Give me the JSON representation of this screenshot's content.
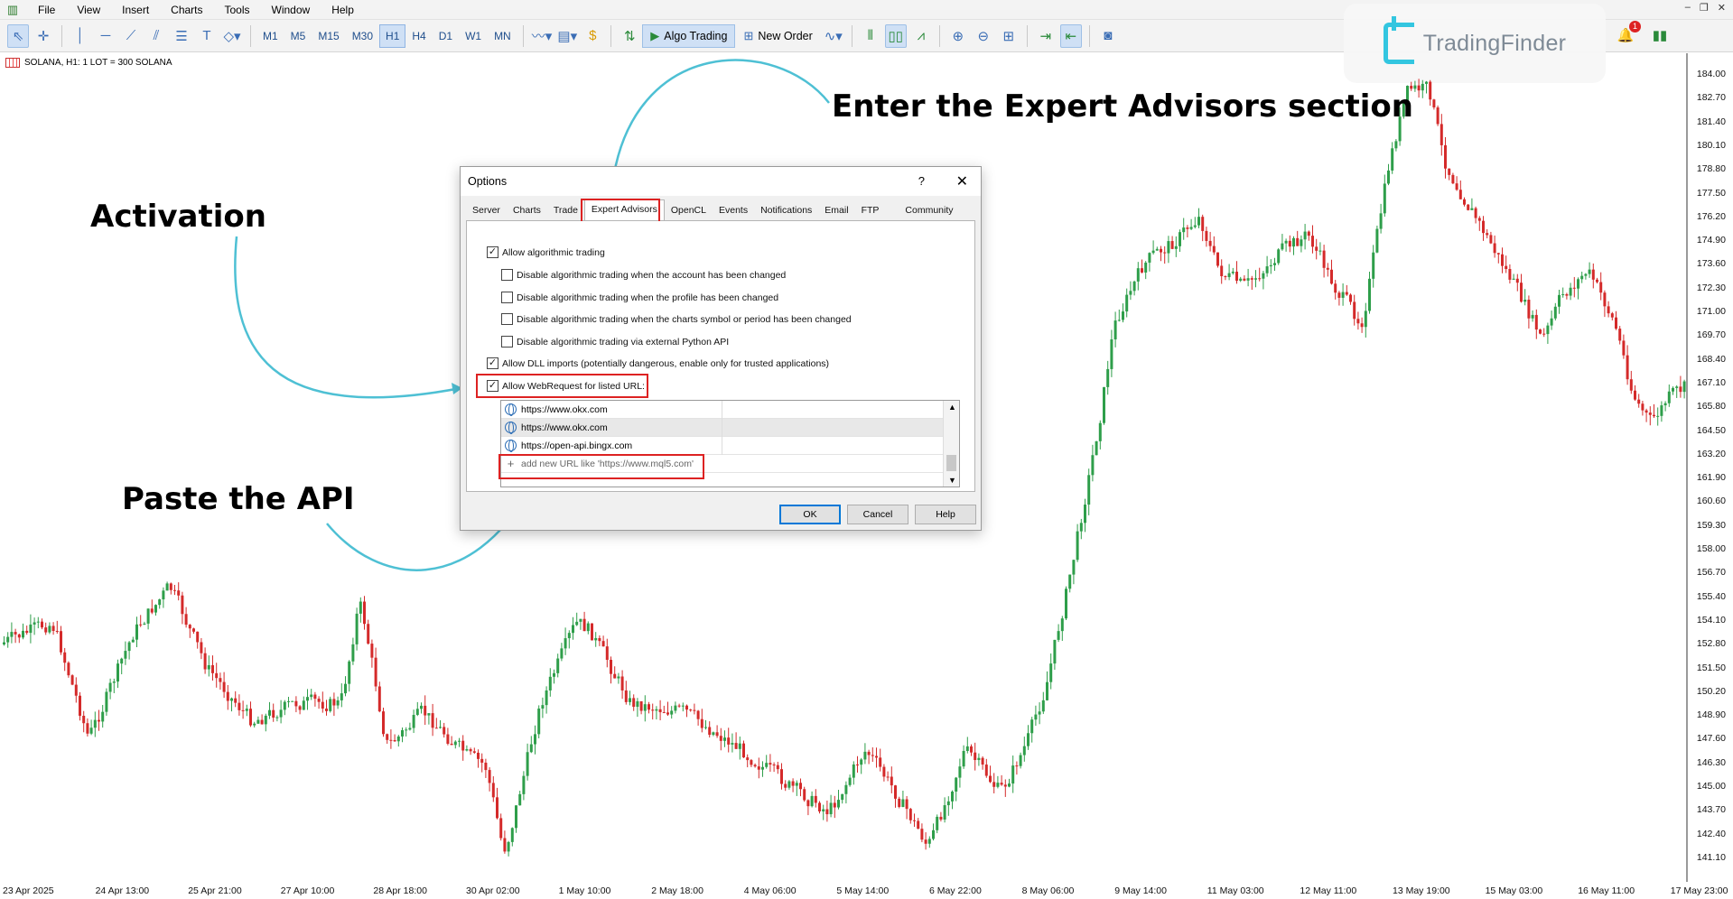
{
  "menu": [
    "File",
    "View",
    "Insert",
    "Charts",
    "Tools",
    "Window",
    "Help"
  ],
  "window_controls": {
    "minimize": "–",
    "restore": "❐",
    "close": "✕"
  },
  "toolbar": {
    "timeframes": [
      "M1",
      "M5",
      "M15",
      "M30",
      "H1",
      "H4",
      "D1",
      "W1",
      "MN"
    ],
    "active_timeframe": "H1",
    "algo_trading_label": "Algo Trading",
    "new_order_label": "New Order",
    "notification_count": "1"
  },
  "logo": {
    "text": "TradingFinder"
  },
  "chart": {
    "symbol_label": "SOLANA, H1:  1 LOT = 300 SOLANA",
    "price_labels": [
      "184.00",
      "182.70",
      "181.40",
      "180.10",
      "178.80",
      "177.50",
      "176.20",
      "174.90",
      "173.60",
      "172.30",
      "171.00",
      "169.70",
      "168.40",
      "167.10",
      "165.80",
      "164.50",
      "163.20",
      "161.90",
      "160.60",
      "159.30",
      "158.00",
      "156.70",
      "155.40",
      "154.10",
      "152.80",
      "151.50",
      "150.20",
      "148.90",
      "147.60",
      "146.30",
      "145.00",
      "143.70",
      "142.40",
      "141.10"
    ],
    "time_labels": [
      "23 Apr 2025",
      "24 Apr 13:00",
      "25 Apr 21:00",
      "27 Apr 10:00",
      "28 Apr 18:00",
      "30 Apr 02:00",
      "1 May 10:00",
      "2 May 18:00",
      "4 May 06:00",
      "5 May 14:00",
      "6 May 22:00",
      "8 May 06:00",
      "9 May 14:00",
      "11 May 03:00",
      "12 May 11:00",
      "13 May 19:00",
      "15 May 03:00",
      "16 May 11:00",
      "17 May 23:00"
    ],
    "bull_color": "#2e9e4a",
    "bear_color": "#d42a2a"
  },
  "annotations": {
    "activation": "Activation",
    "paste_api": "Paste the API",
    "enter_expert": "Enter the Expert Advisors section",
    "arrow_color": "#4ec0d4"
  },
  "dialog": {
    "title": "Options",
    "help_glyph": "?",
    "close_glyph": "✕",
    "tabs": [
      "Server",
      "Charts",
      "Trade",
      "Expert Advisors",
      "OpenCL",
      "Events",
      "Notifications",
      "Email",
      "FTP",
      "Community"
    ],
    "active_tab": "Expert Advisors",
    "options": [
      {
        "label": "Allow algorithmic trading",
        "checked": true,
        "indent": 0
      },
      {
        "label": "Disable algorithmic trading when the account has been changed",
        "checked": false,
        "indent": 1
      },
      {
        "label": "Disable algorithmic trading when the profile has been changed",
        "checked": false,
        "indent": 1
      },
      {
        "label": "Disable algorithmic trading when the charts symbol or period has been changed",
        "checked": false,
        "indent": 1
      },
      {
        "label": "Disable algorithmic trading via external Python API",
        "checked": false,
        "indent": 1
      },
      {
        "label": "Allow DLL imports (potentially dangerous, enable only for trusted applications)",
        "checked": true,
        "indent": 0
      },
      {
        "label": "Allow WebRequest for listed URL:",
        "checked": true,
        "indent": 0
      }
    ],
    "urls": [
      "https://www.okx.com",
      "https://www.okx.com",
      "https://open-api.bingx.com"
    ],
    "add_url_placeholder": "add new URL like 'https://www.mql5.com'",
    "buttons": {
      "ok": "OK",
      "cancel": "Cancel",
      "help": "Help"
    }
  }
}
